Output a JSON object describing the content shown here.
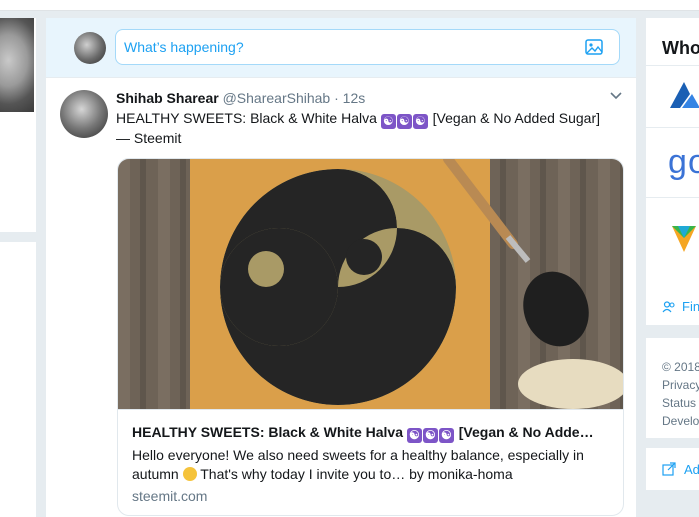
{
  "compose": {
    "placeholder": "What’s happening?"
  },
  "tweet": {
    "name": "Shihab Sharear",
    "handle": "@SharearShihab",
    "separator": "·",
    "time": "12s",
    "text_before": "HEALTHY SWEETS: Black & White Halva",
    "emoji": "☯",
    "text_after": "[Vegan & No Added Sugar] — Steemit",
    "card": {
      "title_before": "HEALTHY SWEETS: Black & White Halva",
      "title_after": "[Vegan & No Adde…",
      "desc_before": "Hello everyone! We also need sweets for a healthy balance, especially in autumn",
      "desc_after": "That's why today I invite you to… by monika-homa",
      "domain": "steemit.com"
    }
  },
  "sidebar": {
    "who_to_follow_title": "Who",
    "find_label": "Fin",
    "footer": [
      "© 2018",
      "Privacy",
      "Status",
      "Develo"
    ],
    "ad_label": "Ad"
  },
  "colors": {
    "accent": "#1da1f2",
    "background": "#e6ecf0",
    "emoji_bg": "#7d55c7"
  }
}
